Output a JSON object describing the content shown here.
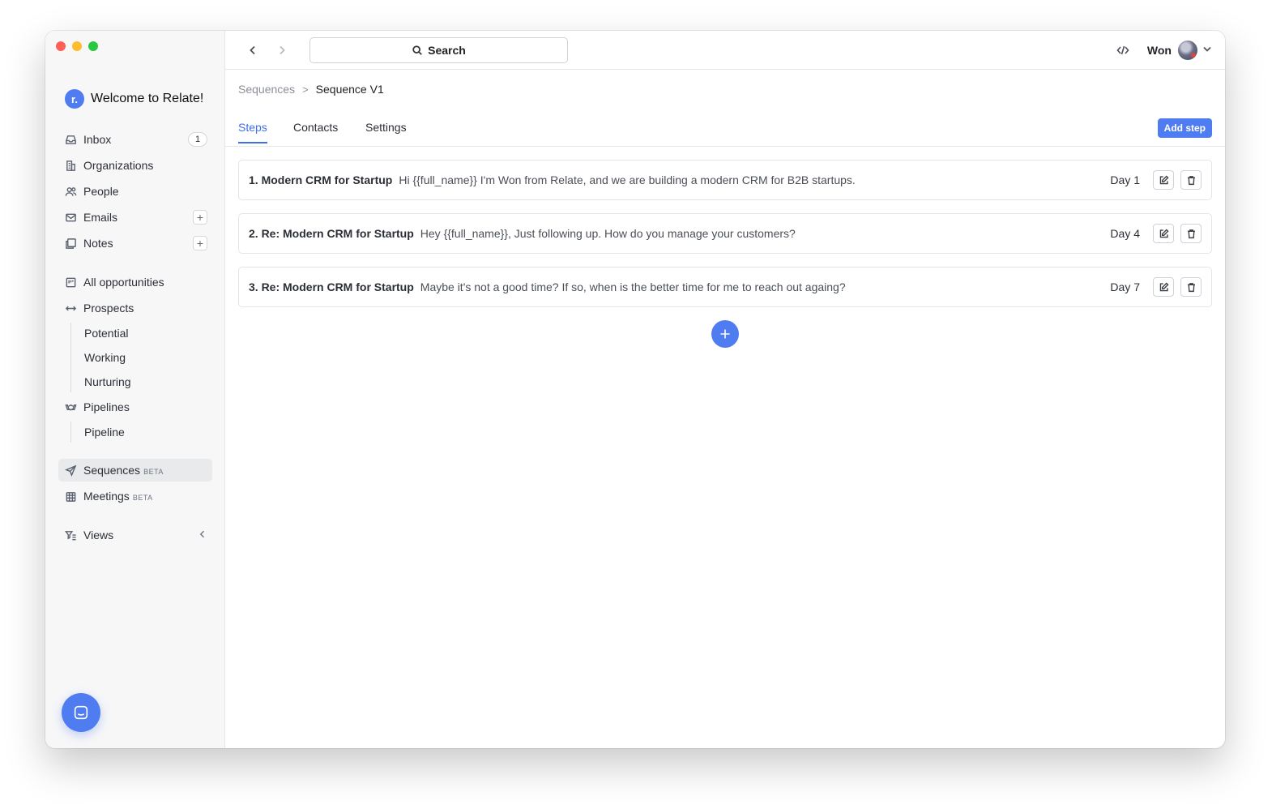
{
  "workspace": {
    "logo_letter": "r.",
    "name": "Welcome to Relate!"
  },
  "sidebar": {
    "inbox": {
      "label": "Inbox",
      "count": "1"
    },
    "organizations": {
      "label": "Organizations"
    },
    "people": {
      "label": "People"
    },
    "emails": {
      "label": "Emails",
      "add": "+"
    },
    "notes": {
      "label": "Notes",
      "add": "+"
    },
    "all_opportunities": {
      "label": "All opportunities"
    },
    "prospects": {
      "label": "Prospects",
      "children": [
        "Potential",
        "Working",
        "Nurturing"
      ]
    },
    "pipelines": {
      "label": "Pipelines",
      "children": [
        "Pipeline"
      ]
    },
    "sequences": {
      "label": "Sequences",
      "badge": "BETA"
    },
    "meetings": {
      "label": "Meetings",
      "badge": "BETA"
    },
    "views": {
      "label": "Views"
    }
  },
  "topbar": {
    "search_label": "Search",
    "user_name": "Won"
  },
  "breadcrumb": {
    "root": "Sequences",
    "separator": ">",
    "current": "Sequence V1"
  },
  "tabs": [
    "Steps",
    "Contacts",
    "Settings"
  ],
  "active_tab": "Steps",
  "add_step_label": "Add step",
  "steps": [
    {
      "title": "1. Modern CRM for Startup",
      "body": "Hi {{full_name}} I'm Won from Relate, and we are building a modern CRM for B2B startups.",
      "day": "Day 1"
    },
    {
      "title": "2. Re: Modern CRM for Startup",
      "body": "Hey {{full_name}}, Just following up. How do you manage your customers?",
      "day": "Day 4"
    },
    {
      "title": "3. Re: Modern CRM for Startup",
      "body": "Maybe it's not a good time? If so, when is the better time for me to reach out againg?",
      "day": "Day 7"
    }
  ],
  "colors": {
    "accent": "#4f7cf0",
    "active_tab": "#3d6fe8",
    "sidebar_bg": "#f7f7f8"
  }
}
